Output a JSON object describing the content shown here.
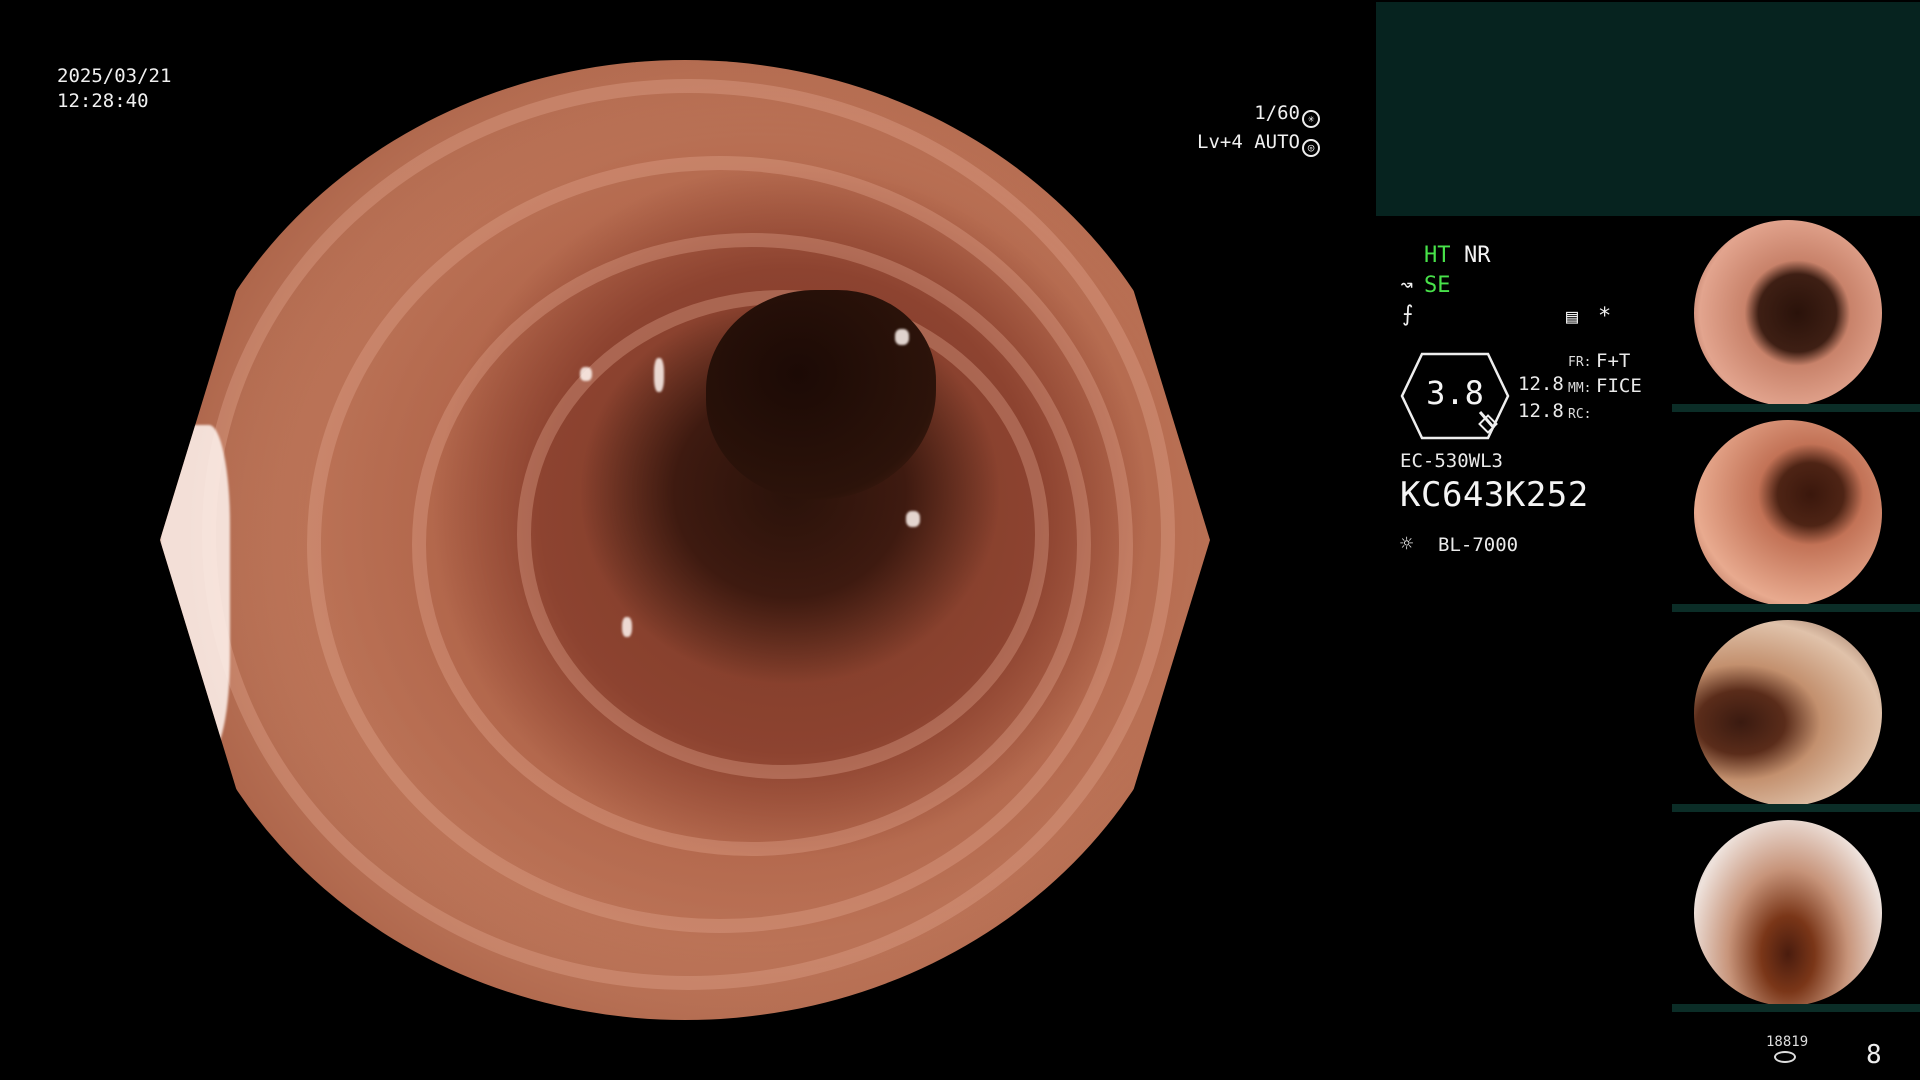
{
  "overlay": {
    "date": "2025/03/21",
    "time": "12:28:40",
    "shutter": "1/60",
    "level": "Lv+4 AUTO"
  },
  "settings": {
    "ht": "HT",
    "nr": "NR",
    "se": "SE",
    "mode_icon": "hand-fold-icon"
  },
  "magnification": {
    "value": "3.8",
    "left_top": "12.8",
    "left_bottom": "12.8",
    "fr_label": "FR:",
    "fr_value": "F+T",
    "mm_label": "MM:",
    "mm_value": "FICE",
    "rc_label": "RC:"
  },
  "scope": {
    "model": "EC-530WL3",
    "serial": "KC643K252",
    "light_source": "BL-7000"
  },
  "footer": {
    "counter": "18819",
    "page": "8"
  },
  "colors": {
    "accent_green": "#48e24a",
    "panel_teal": "#06231f"
  }
}
